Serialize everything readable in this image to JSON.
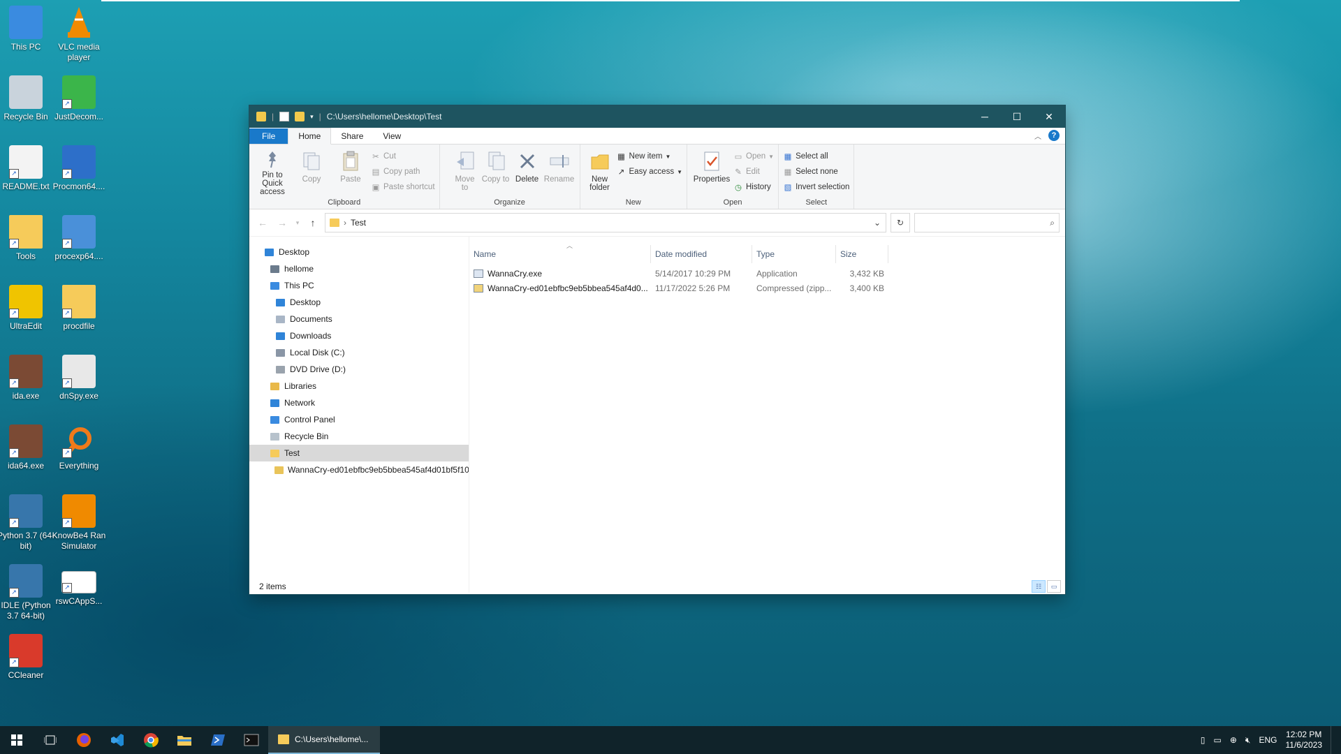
{
  "desktop": {
    "icons": [
      {
        "label": "This PC",
        "icon": "this-pc-icon"
      },
      {
        "label": "VLC media player",
        "icon": "vlc-icon"
      },
      {
        "label": "Recycle Bin",
        "icon": "recycle-bin-icon"
      },
      {
        "label": "JustDecom...",
        "icon": "jd-icon"
      },
      {
        "label": "README.txt",
        "icon": "text-file-icon"
      },
      {
        "label": "Procmon64....",
        "icon": "procmon-icon"
      },
      {
        "label": "Tools",
        "icon": "folder-icon"
      },
      {
        "label": "procexp64....",
        "icon": "procexp-icon"
      },
      {
        "label": "UltraEdit",
        "icon": "ultraedit-icon"
      },
      {
        "label": "procdfile",
        "icon": "folder-icon"
      },
      {
        "label": "ida.exe",
        "icon": "ida-icon"
      },
      {
        "label": "dnSpy.exe",
        "icon": "dnspy-icon"
      },
      {
        "label": "ida64.exe",
        "icon": "ida64-icon"
      },
      {
        "label": "Everything",
        "icon": "everything-icon"
      },
      {
        "label": "Python 3.7 (64-bit)",
        "icon": "python-icon"
      },
      {
        "label": "KnowBe4 Ran Simulator",
        "icon": "knowbe4-icon"
      },
      {
        "label": "IDLE (Python 3.7 64-bit)",
        "icon": "idle-icon"
      },
      {
        "label": "rswCAppS...",
        "icon": "rsw-icon"
      },
      {
        "label": "CCleaner",
        "icon": "ccleaner-icon"
      }
    ]
  },
  "window": {
    "title": "C:\\Users\\hellome\\Desktop\\Test",
    "controls": {
      "minimize": "─",
      "maximize": "☐",
      "close": "✕"
    }
  },
  "ribbon": {
    "tabs": [
      "File",
      "Home",
      "Share",
      "View"
    ],
    "active_tab": "Home",
    "help": "?",
    "clipboard": {
      "label": "Clipboard",
      "pin": "Pin to Quick access",
      "copy": "Copy",
      "paste": "Paste",
      "cut": "Cut",
      "copy_path": "Copy path",
      "paste_shortcut": "Paste shortcut"
    },
    "organize": {
      "label": "Organize",
      "move_to": "Move to",
      "copy_to": "Copy to",
      "delete": "Delete",
      "rename": "Rename"
    },
    "new": {
      "label": "New",
      "new_folder": "New folder",
      "new_item": "New item",
      "easy_access": "Easy access"
    },
    "open": {
      "label": "Open",
      "properties": "Properties",
      "open": "Open",
      "edit": "Edit",
      "history": "History"
    },
    "select": {
      "label": "Select",
      "select_all": "Select all",
      "select_none": "Select none",
      "invert": "Invert selection"
    }
  },
  "address": {
    "path": "Test",
    "search_placeholder": ""
  },
  "navpane": {
    "items": [
      {
        "label": "Desktop",
        "icon": "desktop-icon",
        "indent": 0
      },
      {
        "label": "hellome",
        "icon": "user-icon",
        "indent": 1
      },
      {
        "label": "This PC",
        "icon": "this-pc-icon",
        "indent": 1
      },
      {
        "label": "Desktop",
        "icon": "desktop-icon",
        "indent": 2
      },
      {
        "label": "Documents",
        "icon": "documents-icon",
        "indent": 2
      },
      {
        "label": "Downloads",
        "icon": "downloads-icon",
        "indent": 2
      },
      {
        "label": "Local Disk (C:)",
        "icon": "disk-icon",
        "indent": 2
      },
      {
        "label": "DVD Drive (D:)",
        "icon": "dvd-icon",
        "indent": 2
      },
      {
        "label": "Libraries",
        "icon": "libraries-icon",
        "indent": 1
      },
      {
        "label": "Network",
        "icon": "network-icon",
        "indent": 1
      },
      {
        "label": "Control Panel",
        "icon": "control-panel-icon",
        "indent": 1
      },
      {
        "label": "Recycle Bin",
        "icon": "recycle-bin-icon",
        "indent": 1
      },
      {
        "label": "Test",
        "icon": "folder-icon",
        "indent": 1,
        "selected": true
      },
      {
        "label": "WannaCry-ed01ebfbc9eb5bbea545af4d01bf5f10",
        "icon": "zip-icon",
        "indent": 2
      }
    ]
  },
  "files": {
    "columns": [
      "Name",
      "Date modified",
      "Type",
      "Size"
    ],
    "rows": [
      {
        "name": "WannaCry.exe",
        "date": "5/14/2017 10:29 PM",
        "type": "Application",
        "size": "3,432 KB",
        "icon": "exe-icon"
      },
      {
        "name": "WannaCry-ed01ebfbc9eb5bbea545af4d0...",
        "date": "11/17/2022 5:26 PM",
        "type": "Compressed (zipp...",
        "size": "3,400 KB",
        "icon": "zip-icon"
      }
    ]
  },
  "status": {
    "items_count": "2 items"
  },
  "taskbar": {
    "task_label": "C:\\Users\\hellome\\...",
    "language": "ENG",
    "time": "12:02 PM",
    "date": "11/6/2023"
  }
}
